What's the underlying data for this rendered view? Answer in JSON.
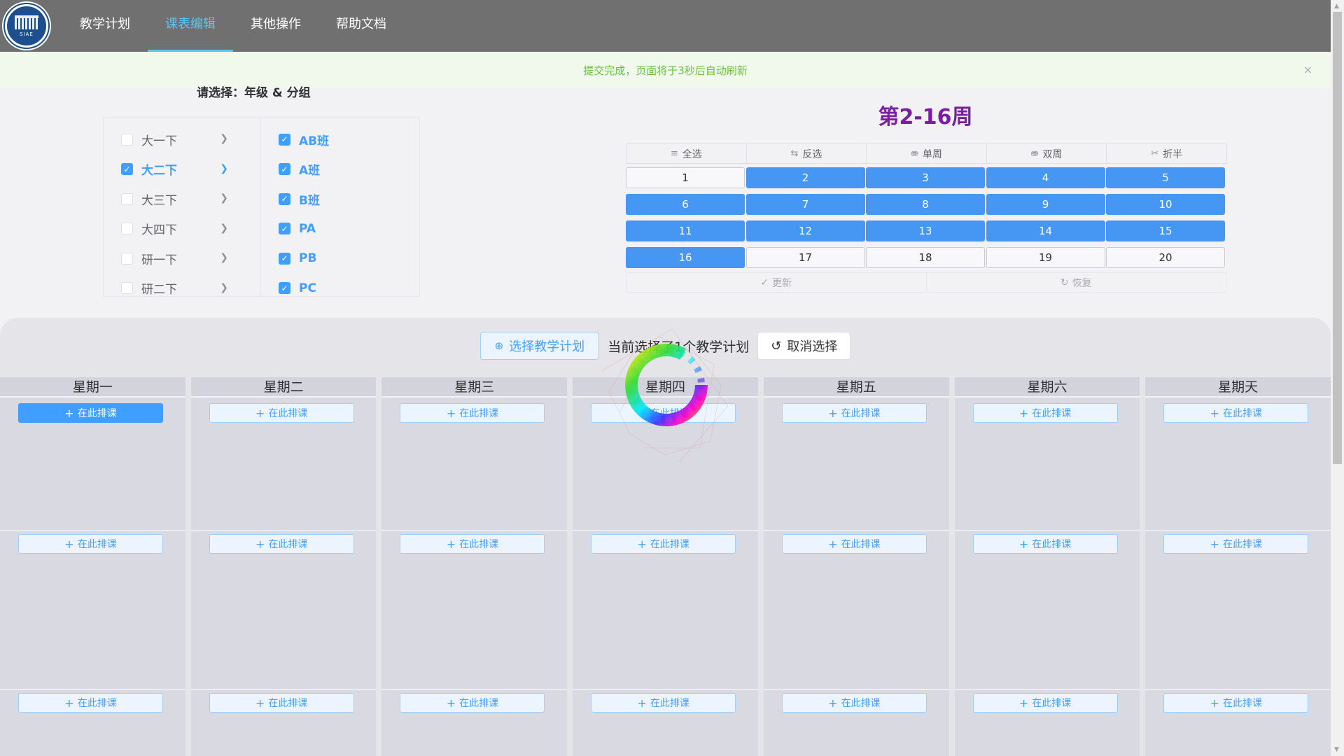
{
  "nav": {
    "logo_text": "SIAE",
    "items": [
      {
        "label": "教学计划",
        "active": false
      },
      {
        "label": "课表编辑",
        "active": true
      },
      {
        "label": "其他操作",
        "active": false
      },
      {
        "label": "帮助文档",
        "active": false
      }
    ]
  },
  "alert": {
    "message": "提交完成，页面将于3秒后自动刷新",
    "close": "×"
  },
  "selector": {
    "title": "请选择：年级 & 分组",
    "grades": [
      {
        "label": "大一下",
        "checked": false
      },
      {
        "label": "大二下",
        "checked": true
      },
      {
        "label": "大三下",
        "checked": false
      },
      {
        "label": "大四下",
        "checked": false
      },
      {
        "label": "研一下",
        "checked": false
      },
      {
        "label": "研二下",
        "checked": false
      }
    ],
    "groups": [
      {
        "label": "AB班",
        "checked": true
      },
      {
        "label": "A班",
        "checked": true
      },
      {
        "label": "B班",
        "checked": true
      },
      {
        "label": "PA",
        "checked": true
      },
      {
        "label": "PB",
        "checked": true
      },
      {
        "label": "PC",
        "checked": true
      }
    ]
  },
  "weeks": {
    "title": "第2-16周",
    "tools": [
      {
        "label": "全选",
        "icon": "select-all-icon"
      },
      {
        "label": "反选",
        "icon": "invert-icon"
      },
      {
        "label": "单周",
        "icon": "coins-icon"
      },
      {
        "label": "双周",
        "icon": "coins-icon"
      },
      {
        "label": "折半",
        "icon": "scissors-icon"
      }
    ],
    "items": [
      {
        "n": "1",
        "on": false
      },
      {
        "n": "2",
        "on": true
      },
      {
        "n": "3",
        "on": true
      },
      {
        "n": "4",
        "on": true
      },
      {
        "n": "5",
        "on": true
      },
      {
        "n": "6",
        "on": true
      },
      {
        "n": "7",
        "on": true
      },
      {
        "n": "8",
        "on": true
      },
      {
        "n": "9",
        "on": true
      },
      {
        "n": "10",
        "on": true
      },
      {
        "n": "11",
        "on": true
      },
      {
        "n": "12",
        "on": true
      },
      {
        "n": "13",
        "on": true
      },
      {
        "n": "14",
        "on": true
      },
      {
        "n": "15",
        "on": true
      },
      {
        "n": "16",
        "on": true
      },
      {
        "n": "17",
        "on": false
      },
      {
        "n": "18",
        "on": false
      },
      {
        "n": "19",
        "on": false
      },
      {
        "n": "20",
        "on": false
      }
    ],
    "update_label": "更新",
    "restore_label": "恢复"
  },
  "plan_bar": {
    "select_label": "选择教学计划",
    "status_text": "当前选择了1个教学计划",
    "cancel_label": "取消选择"
  },
  "schedule": {
    "add_label": "在此排课",
    "days": [
      "星期一",
      "星期二",
      "星期三",
      "星期四",
      "星期五",
      "星期六",
      "星期天"
    ]
  },
  "colors": {
    "primary": "#409eff",
    "week_on": "#4696f3",
    "nav_bg": "#707070",
    "nav_active": "#58c6f0",
    "success": "#67c23a",
    "title_purple": "#7b1fa2"
  }
}
